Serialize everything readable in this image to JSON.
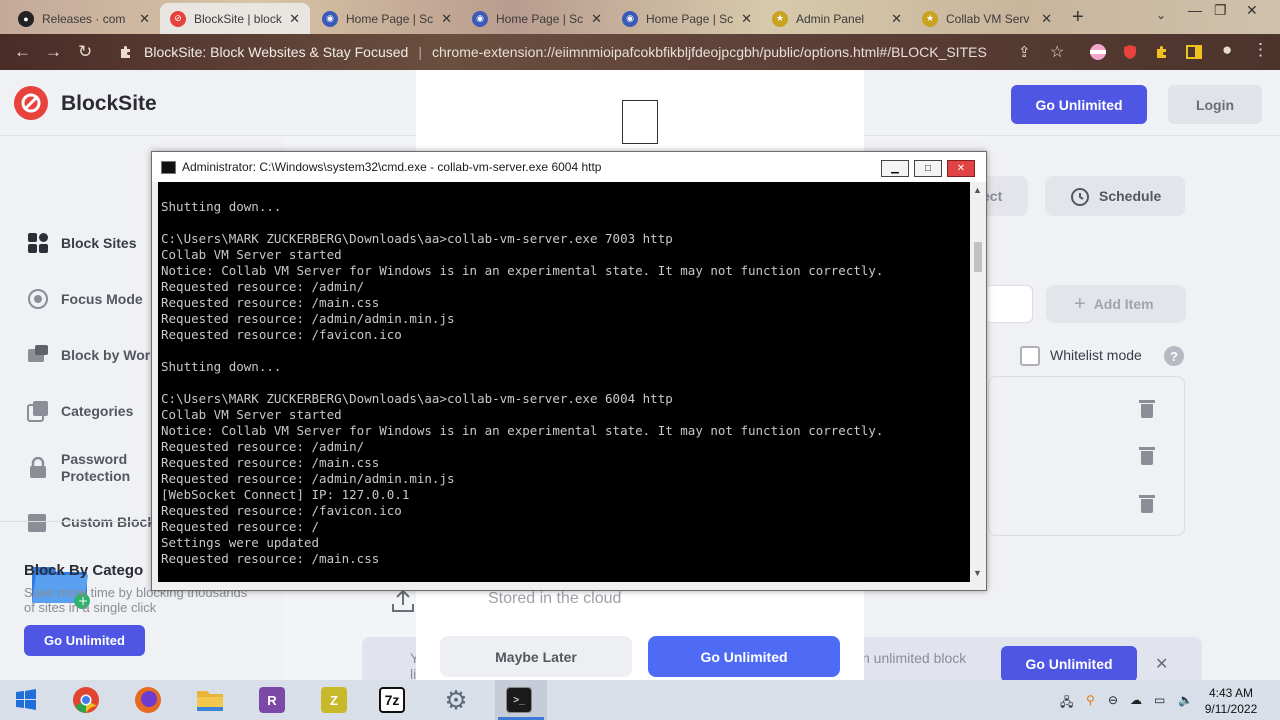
{
  "browser": {
    "tabs": [
      {
        "title": "Releases · com",
        "favicon_color": "#222222",
        "favicon_glyph": "github-icon",
        "active": false
      },
      {
        "title": "BlockSite | block",
        "favicon_color": "#e8423c",
        "favicon_glyph": "blocksite-icon",
        "active": true
      },
      {
        "title": "Home Page | Sc",
        "favicon_color": "#3b5bb8",
        "favicon_glyph": "globe-icon",
        "active": false
      },
      {
        "title": "Home Page | Sc",
        "favicon_color": "#3b5bb8",
        "favicon_glyph": "globe-icon",
        "active": false
      },
      {
        "title": "Home Page | Sc",
        "favicon_color": "#3b5bb8",
        "favicon_glyph": "globe-icon",
        "active": false
      },
      {
        "title": "Admin Panel",
        "favicon_color": "#c9a21f",
        "favicon_glyph": "admin-icon",
        "active": false
      },
      {
        "title": "Collab VM Serv",
        "favicon_color": "#c9a21f",
        "favicon_glyph": "collab-icon",
        "active": false
      }
    ],
    "page_title": "BlockSite: Block Websites & Stay Focused",
    "url": "chrome-extension://eiimnmioipafcokbfikbljfdeojpcgbh/public/options.html#/BLOCK_SITES"
  },
  "blocksite": {
    "brand": "BlockSite",
    "go_unlimited": "Go Unlimited",
    "login": "Login",
    "sidebar": [
      {
        "label": "Block Sites",
        "icon": "grid-icon"
      },
      {
        "label": "Focus Mode",
        "icon": "target-icon"
      },
      {
        "label": "Block by Wor",
        "icon": "word-icon"
      },
      {
        "label": "Categories",
        "icon": "categories-icon"
      },
      {
        "label": "Password\nProtection",
        "icon": "lock-icon"
      },
      {
        "label": "Custom Block",
        "icon": "custom-icon"
      }
    ],
    "promo": {
      "title": "Block By Catego",
      "desc": "Save more time by blocking thousands of sites in a single click",
      "button": "Go Unlimited"
    },
    "right": {
      "redirect_partial": "ect",
      "schedule": "Schedule",
      "add_item": "Add Item",
      "whitelist": "Whitelist mode",
      "help": "?"
    },
    "banner": {
      "left_text": "Y",
      "left_text2": "li",
      "text": "n unlimited block",
      "button": "Go Unlimited"
    },
    "modal": {
      "cloud_text": "Stored in the cloud",
      "maybe_later": "Maybe Later",
      "go_unlimited": "Go Unlimited"
    }
  },
  "cmd": {
    "title": "Administrator: C:\\Windows\\system32\\cmd.exe - collab-vm-server.exe  6004 http",
    "lines": [
      "Shutting down...",
      "",
      "C:\\Users\\MARK ZUCKERBERG\\Downloads\\aa>collab-vm-server.exe 7003 http",
      "Collab VM Server started",
      "Notice: Collab VM Server for Windows is in an experimental state. It may not function correctly.",
      "Requested resource: /admin/",
      "Requested resource: /main.css",
      "Requested resource: /admin/admin.min.js",
      "Requested resource: /favicon.ico",
      "",
      "Shutting down...",
      "",
      "C:\\Users\\MARK ZUCKERBERG\\Downloads\\aa>collab-vm-server.exe 6004 http",
      "Collab VM Server started",
      "Notice: Collab VM Server for Windows is in an experimental state. It may not function correctly.",
      "Requested resource: /admin/",
      "Requested resource: /main.css",
      "Requested resource: /admin/admin.min.js",
      "[WebSocket Connect] IP: 127.0.0.1",
      "Requested resource: /favicon.ico",
      "Requested resource: /",
      "Settings were updated",
      "Requested resource: /main.css"
    ]
  },
  "taskbar": {
    "apps": [
      {
        "name": "windows-start-icon",
        "color": "#1e6fd9"
      },
      {
        "name": "chrome-icon",
        "color": "#e0452f"
      },
      {
        "name": "firefox-icon",
        "color": "#e66a1f"
      },
      {
        "name": "file-explorer-icon",
        "color": "#e8b43a"
      },
      {
        "name": "rufus-icon",
        "color": "#7b4aa8"
      },
      {
        "name": "zotero-icon",
        "color": "#c8b92a"
      },
      {
        "name": "7zip-icon",
        "color": "#1a1a1a"
      },
      {
        "name": "settings-icon",
        "color": "#5f6b78"
      },
      {
        "name": "cmd-icon",
        "color": "#1a1a1a"
      }
    ],
    "seven_zip_label": "7z",
    "time": "4:43 AM",
    "date": "9/11/2022"
  }
}
